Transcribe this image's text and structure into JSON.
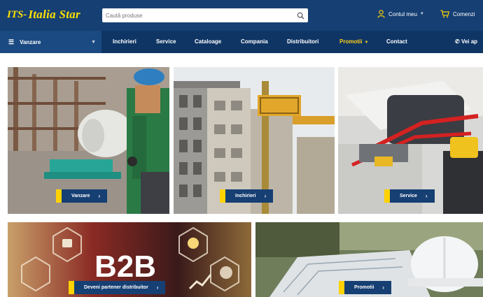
{
  "header": {
    "logo_its": "ITS-",
    "logo_name": "Italia Star",
    "search_placeholder": "Caută produse",
    "account_label": "Contul meu",
    "cart_label": "Comenzi"
  },
  "nav": {
    "categories_label": "Vanzare",
    "links": [
      "Inchirieri",
      "Service",
      "Cataloage",
      "Compania",
      "Distribuitori",
      "Promotii",
      "Contact"
    ],
    "phone": "Vei ap"
  },
  "tiles": {
    "vanzare": "Vanzare",
    "inchirieri": "Inchirieri",
    "service": "Service",
    "b2b_image_text": "B2B",
    "distribuitor": "Deveni partener distribuitor",
    "promotii": "Promotii"
  },
  "colors": {
    "header_bg": "#163f73",
    "nav_bg": "#0f3565",
    "accent_yellow": "#ffd200",
    "button_blue": "#163f73"
  }
}
